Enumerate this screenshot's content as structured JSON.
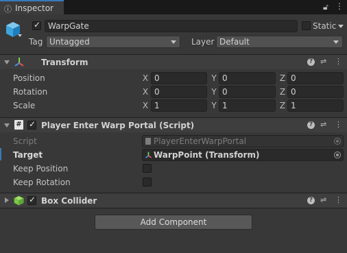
{
  "tab": {
    "label": "Inspector",
    "icon": "info-icon"
  },
  "gameobject": {
    "active": true,
    "name": "WarpGate",
    "static_label": "Static",
    "static_checked": false,
    "tag_label": "Tag",
    "tag_value": "Untagged",
    "layer_label": "Layer",
    "layer_value": "Default"
  },
  "transform": {
    "title": "Transform",
    "rows": [
      {
        "label": "Position",
        "x": "0",
        "y": "0",
        "z": "0"
      },
      {
        "label": "Rotation",
        "x": "0",
        "y": "0",
        "z": "0"
      },
      {
        "label": "Scale",
        "x": "1",
        "y": "1",
        "z": "1"
      }
    ],
    "axes": [
      "X",
      "Y",
      "Z"
    ]
  },
  "script_component": {
    "title": "Player Enter Warp Portal (Script)",
    "enabled": true,
    "script_label": "Script",
    "script_value": "PlayerEnterWarpPortal",
    "target_label": "Target",
    "target_value": "WarpPoint (Transform)",
    "keep_position_label": "Keep Position",
    "keep_position": false,
    "keep_rotation_label": "Keep Rotation",
    "keep_rotation": false
  },
  "box_collider": {
    "title": "Box Collider",
    "enabled": true
  },
  "add_component_label": "Add Component",
  "colors": {
    "background": "#383838",
    "accent": "#3a79bb",
    "field": "#2a2a2a"
  }
}
